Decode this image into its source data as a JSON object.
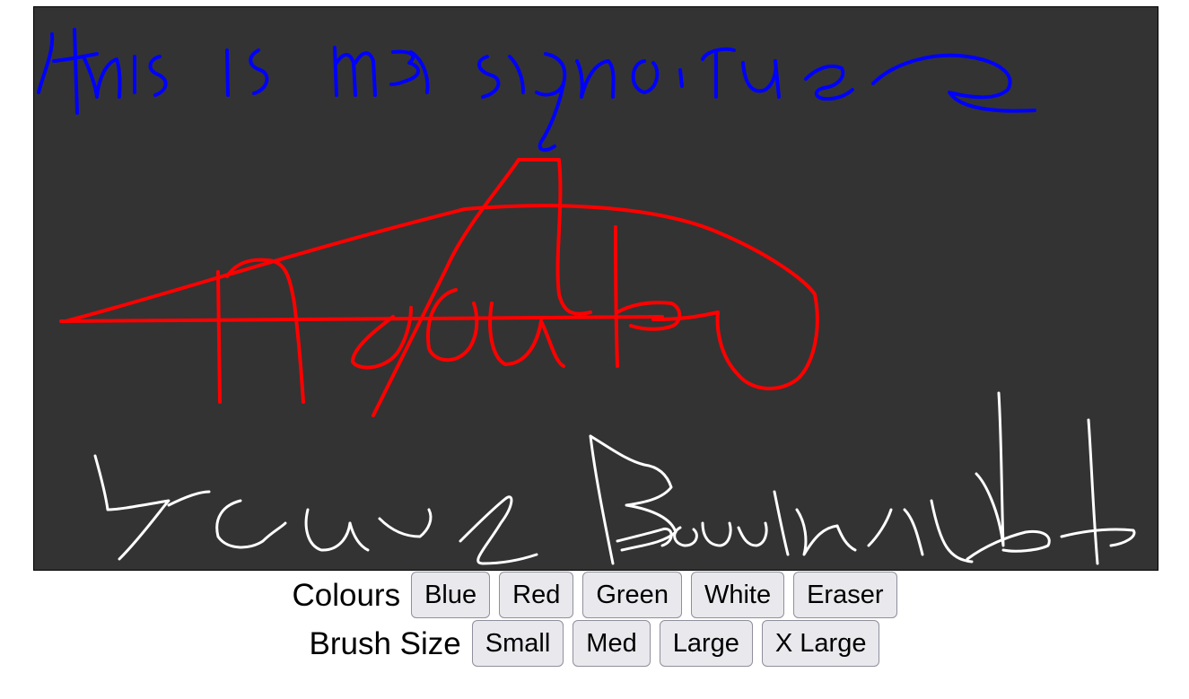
{
  "toolbar": {
    "colours_label": "Colours",
    "brush_size_label": "Brush Size",
    "colour_buttons": [
      {
        "label": "Blue",
        "color": "#0000ff"
      },
      {
        "label": "Red",
        "color": "#ff0000"
      },
      {
        "label": "Green",
        "color": "#00ff00"
      },
      {
        "label": "White",
        "color": "#ffffff"
      },
      {
        "label": "Eraser",
        "color": "#333333"
      }
    ],
    "size_buttons": [
      {
        "label": "Small"
      },
      {
        "label": "Med"
      },
      {
        "label": "Large"
      },
      {
        "label": "X Large"
      }
    ]
  },
  "canvas": {
    "background": "#333333",
    "handwritten_content": [
      "this is my signature",
      "Abdul",
      "your Beautiful"
    ],
    "stroke_colors": [
      "#0000ff",
      "#ff0000",
      "#ffffff"
    ]
  }
}
